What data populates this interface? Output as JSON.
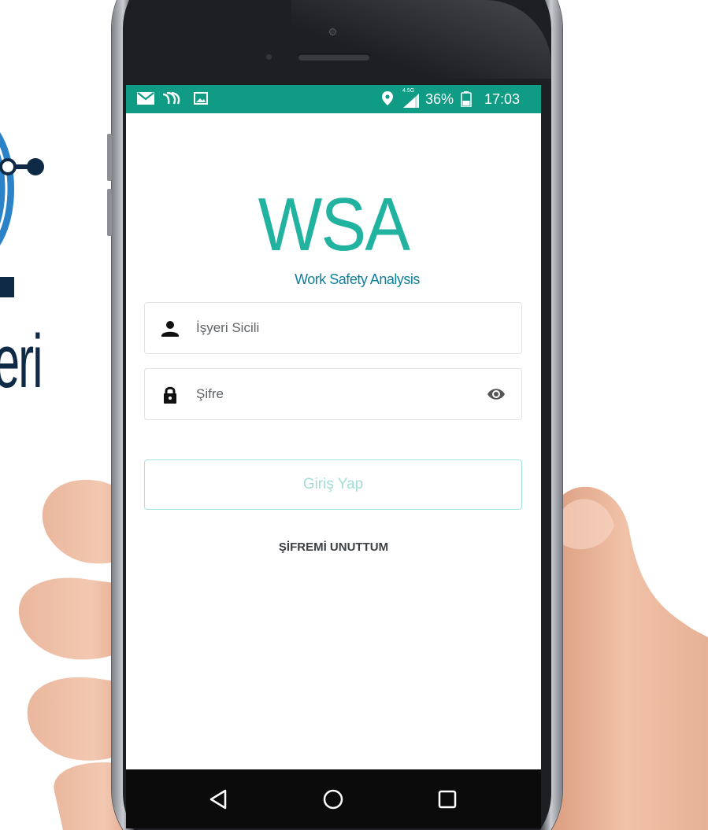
{
  "background": {
    "brand_text_fragment": "eri",
    "brand_colors": {
      "navy": "#0e2a47",
      "blue": "#2a83c8"
    }
  },
  "status_bar": {
    "network_label": "4.5G",
    "battery": "36%",
    "time": "17:03",
    "left_icons": [
      "mail-icon",
      "cast-icon",
      "image-icon"
    ],
    "right_icons": [
      "location-icon",
      "signal-icon",
      "battery-icon"
    ],
    "color": "#0f9b84"
  },
  "app": {
    "logo_title": "WSA",
    "logo_subtitle": "Work Safety Analysis",
    "accent_color": "#22b3a0"
  },
  "login_form": {
    "username": {
      "placeholder": "İşyeri Sicili",
      "value": "",
      "icon": "user-icon"
    },
    "password": {
      "placeholder": "Şifre",
      "value": "",
      "icon": "lock-icon",
      "toggle_icon": "eye-icon"
    },
    "submit_label": "Giriş Yap",
    "forgot_label": "ŞİFREMİ UNUTTUM"
  },
  "nav_bar": {
    "buttons": [
      "back-icon",
      "home-icon",
      "recents-icon"
    ]
  }
}
